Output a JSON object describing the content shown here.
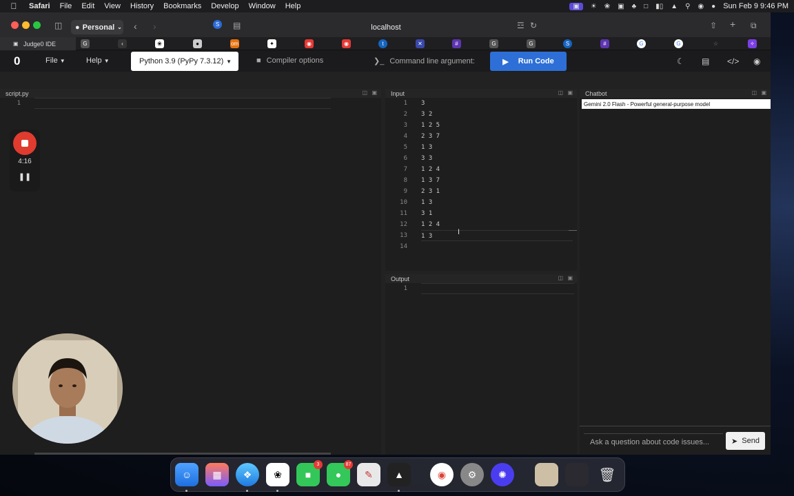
{
  "menubar": {
    "app": "Safari",
    "items": [
      "File",
      "Edit",
      "View",
      "History",
      "Bookmarks",
      "Develop",
      "Window",
      "Help"
    ],
    "clock": "Sun Feb 9  9:46 PM"
  },
  "safari": {
    "profile": "Personal",
    "url": "localhost",
    "active_tab_title": "Judge0 IDE"
  },
  "app": {
    "logo": "0",
    "file_menu": "File",
    "help_menu": "Help",
    "language": "Python 3.9 (PyPy 7.3.12)",
    "compiler_options": "Compiler options",
    "command_line_args": "Command line argument:",
    "run_label": "Run Code"
  },
  "editor": {
    "title": "script.py",
    "line_numbers": [
      "1"
    ],
    "lines": [
      ""
    ]
  },
  "input_panel": {
    "title": "Input",
    "line_numbers": [
      "1",
      "2",
      "3",
      "4",
      "5",
      "6",
      "7",
      "8",
      "9",
      "10",
      "11",
      "12",
      "13",
      "14"
    ],
    "lines": [
      "3",
      "3 2",
      "1 2 5",
      "2 3 7",
      "1 3",
      "3 3",
      "1 2 4",
      "1 3 7",
      "2 3 1",
      "1 3",
      "3 1",
      "1 2 4",
      "1 3",
      ""
    ]
  },
  "output_panel": {
    "title": "Output",
    "line_numbers": [
      "1"
    ],
    "lines": [
      ""
    ]
  },
  "chat": {
    "title": "Chatbot",
    "model": "Gemini 2.0 Flash - Powerful general-purpose model",
    "placeholder": "Ask a question about code issues...",
    "send_label": "Send"
  },
  "recorder": {
    "time": "4:16"
  },
  "dock": {
    "facetime_badge": "3",
    "messages_badge": "87"
  }
}
